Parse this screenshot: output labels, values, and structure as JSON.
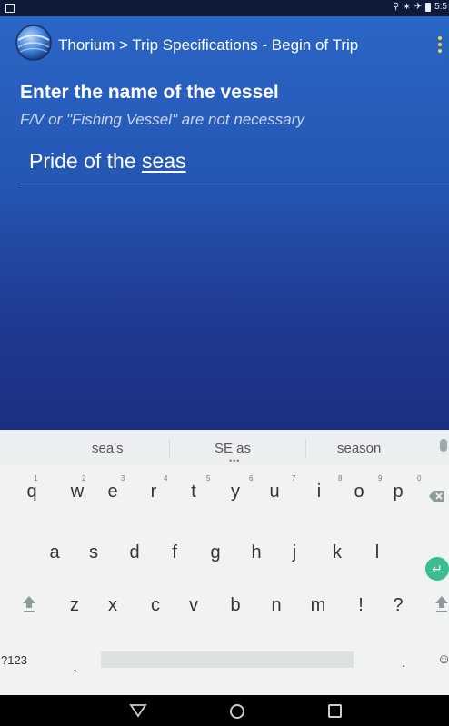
{
  "status_bar": {
    "time": "5:5"
  },
  "app_bar": {
    "title": "Thorium > Trip Specifications - Begin of Trip"
  },
  "form": {
    "heading": "Enter the name of the vessel",
    "subheading": "F/V or \"Fishing Vessel\" are not necessary",
    "input_prefix": "Pride of the ",
    "input_underlined_word": "seas"
  },
  "keyboard": {
    "suggestions": [
      "sea's",
      "SE as",
      "season"
    ],
    "row1": [
      "q",
      "w",
      "e",
      "r",
      "t",
      "y",
      "u",
      "i",
      "o",
      "p"
    ],
    "row1_numbers": [
      "1",
      "2",
      "3",
      "4",
      "5",
      "6",
      "7",
      "8",
      "9",
      "0"
    ],
    "row2": [
      "a",
      "s",
      "d",
      "f",
      "g",
      "h",
      "j",
      "k",
      "l"
    ],
    "row3": [
      "z",
      "x",
      "c",
      "v",
      "b",
      "n",
      "m",
      "!",
      "?"
    ],
    "symbols_key": "?123",
    "comma_key": ",",
    "period_key": "."
  },
  "icons": {
    "app_logo": "globe-logo-icon",
    "overflow": "more-vert-icon",
    "mic": "microphone-icon",
    "backspace": "backspace-icon",
    "enter": "enter-icon",
    "shift": "shift-icon",
    "emoji": "emoji-icon",
    "nav_back": "back-triangle-icon",
    "nav_home": "home-circle-icon",
    "nav_recent": "recent-square-icon"
  },
  "colors": {
    "accent_enter": "#3dbd8f",
    "overflow_dots": "#f2d34c",
    "input_line": "#7fb4ff"
  }
}
